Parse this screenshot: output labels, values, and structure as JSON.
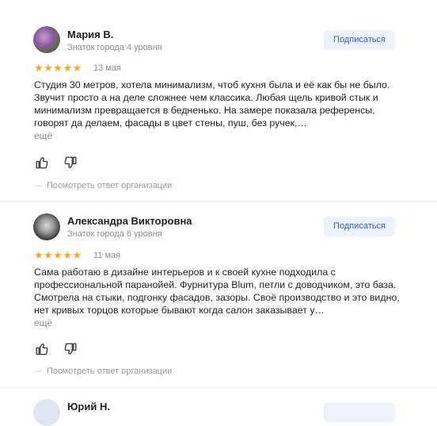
{
  "reviews": [
    {
      "author": "Мария В.",
      "level": "Знаток города 4 уровня",
      "subscribe_label": "Подписаться",
      "stars": "★★★★★",
      "rating": 5,
      "date": "13 мая",
      "text": "Студия 30 метров, хотела минимализм, чтоб кухня была и её как бы не было. Звучит просто а на деле сложнее чем классика. Любая щель кривой стык и минимализм превращается в бедненько. На замере показала референсы, говорят да делаем, фасады в цвет стены, пуш, без ручек,…",
      "more_label": "ещё",
      "org_reply_label": "Посмотреть ответ организации"
    },
    {
      "author": "Александра Викторовна",
      "level": "Знаток города 6 уровня",
      "subscribe_label": "Подписаться",
      "stars": "★★★★★",
      "rating": 5,
      "date": "11 мая",
      "text": "Сама работаю в дизайне интерьеров и к своей кухне подходила с профессиональной паранойей. Фурнитура Blum, петли с доводчиком, это база. Смотрела на стыки, подгонку фасадов, зазоры. Своё производство и это видно, нет кривых торцов которые бывают когда салон заказывает у…",
      "more_label": "ещё",
      "org_reply_label": "Посмотреть ответ организации"
    },
    {
      "author": "Юрий Н."
    }
  ],
  "icons": {
    "like": "thumbs-up-icon",
    "dislike": "thumbs-down-icon"
  },
  "colors": {
    "accent": "#2f5fd0",
    "stars": "#f5a623",
    "button_bg": "#eef2fb"
  }
}
